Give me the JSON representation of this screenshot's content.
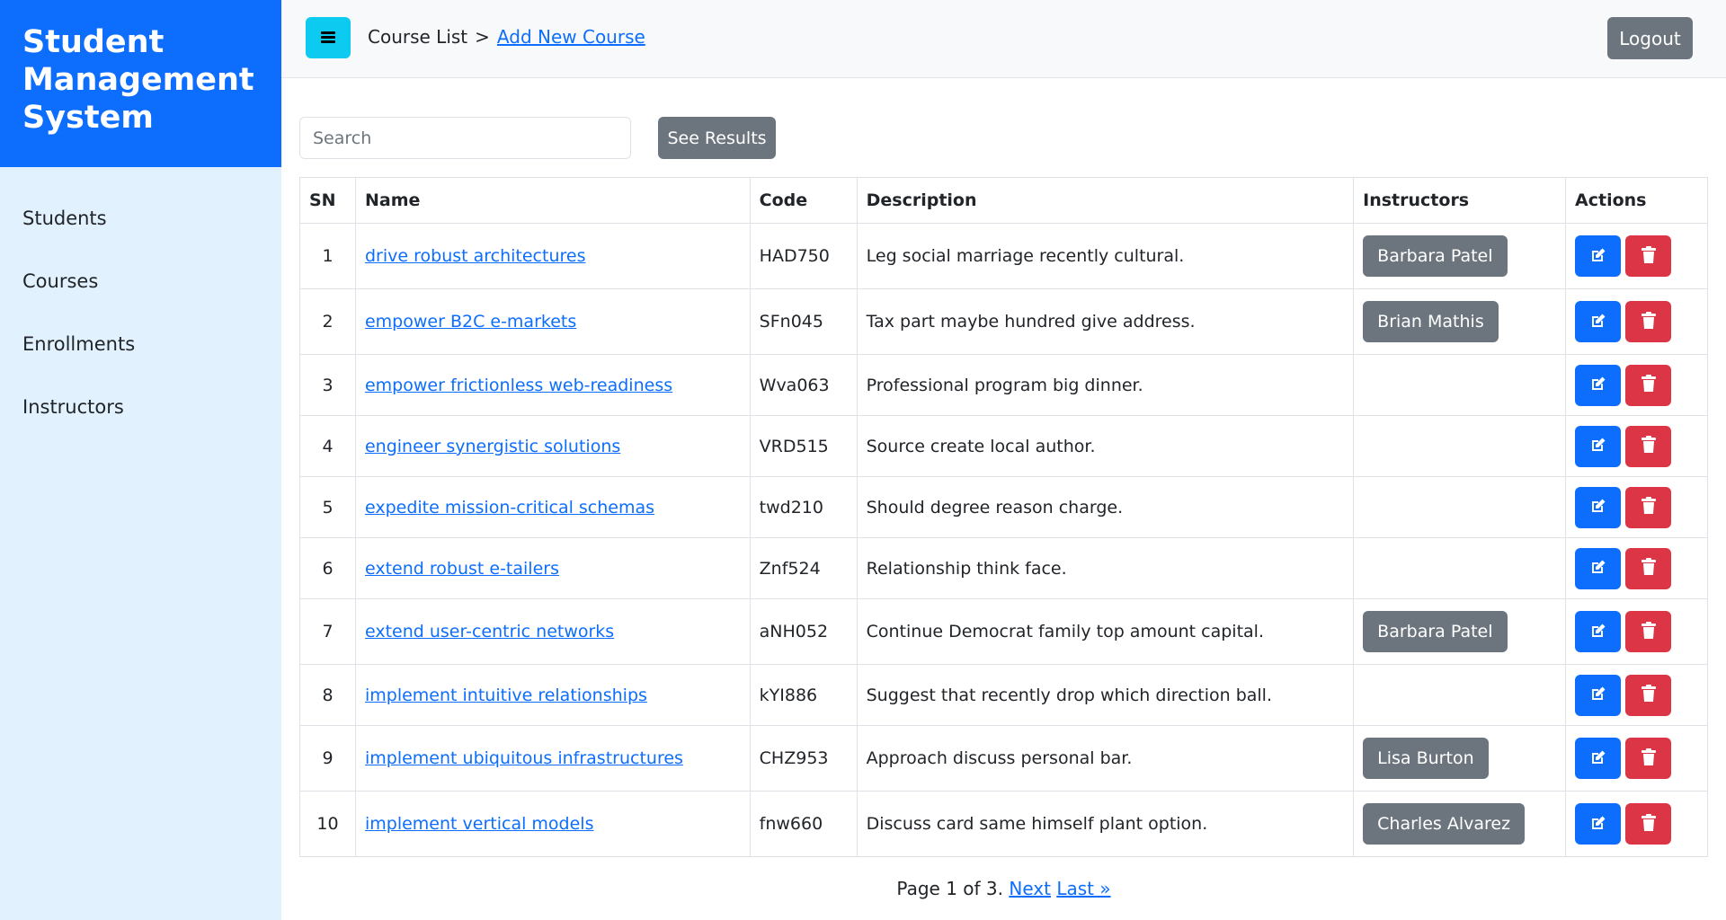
{
  "sidebar": {
    "brand": [
      "Student",
      "Management",
      "System"
    ],
    "items": [
      "Students",
      "Courses",
      "Enrollments",
      "Instructors"
    ]
  },
  "header": {
    "breadcrumb_root": "Course List",
    "breadcrumb_sep": ">",
    "breadcrumb_link": "Add New Course",
    "logout_label": "Logout"
  },
  "search": {
    "placeholder": "Search",
    "button_label": "See Results"
  },
  "table": {
    "headers": [
      "SN",
      "Name",
      "Code",
      "Description",
      "Instructors",
      "Actions"
    ],
    "rows": [
      {
        "sn": "1",
        "name": "drive robust architectures",
        "code": "HAD750",
        "description": "Leg social marriage recently cultural.",
        "instructor": "Barbara Patel"
      },
      {
        "sn": "2",
        "name": "empower B2C e-markets",
        "code": "SFn045",
        "description": "Tax part maybe hundred give address.",
        "instructor": "Brian Mathis"
      },
      {
        "sn": "3",
        "name": "empower frictionless web-readiness",
        "code": "Wva063",
        "description": "Professional program big dinner.",
        "instructor": ""
      },
      {
        "sn": "4",
        "name": "engineer synergistic solutions",
        "code": "VRD515",
        "description": "Source create local author.",
        "instructor": ""
      },
      {
        "sn": "5",
        "name": "expedite mission-critical schemas",
        "code": "twd210",
        "description": "Should degree reason charge.",
        "instructor": ""
      },
      {
        "sn": "6",
        "name": "extend robust e-tailers",
        "code": "Znf524",
        "description": "Relationship think face.",
        "instructor": ""
      },
      {
        "sn": "7",
        "name": "extend user-centric networks",
        "code": "aNH052",
        "description": "Continue Democrat family top amount capital.",
        "instructor": "Barbara Patel"
      },
      {
        "sn": "8",
        "name": "implement intuitive relationships",
        "code": "kYI886",
        "description": "Suggest that recently drop which direction ball.",
        "instructor": ""
      },
      {
        "sn": "9",
        "name": "implement ubiquitous infrastructures",
        "code": "CHZ953",
        "description": "Approach discuss personal bar.",
        "instructor": "Lisa Burton"
      },
      {
        "sn": "10",
        "name": "implement vertical models",
        "code": "fnw660",
        "description": "Discuss card same himself plant option.",
        "instructor": "Charles Alvarez"
      }
    ]
  },
  "pagination": {
    "text": "Page 1 of 3.",
    "next": "Next",
    "last": "Last »"
  },
  "icons": {
    "menu": "hamburger-icon",
    "edit": "edit-icon",
    "delete": "trash-icon"
  },
  "colors": {
    "primary": "#0d6efd",
    "info": "#0dcaf0",
    "secondary": "#6c757d",
    "danger": "#dc3545",
    "sidebar_bg": "#e2f1fe"
  }
}
